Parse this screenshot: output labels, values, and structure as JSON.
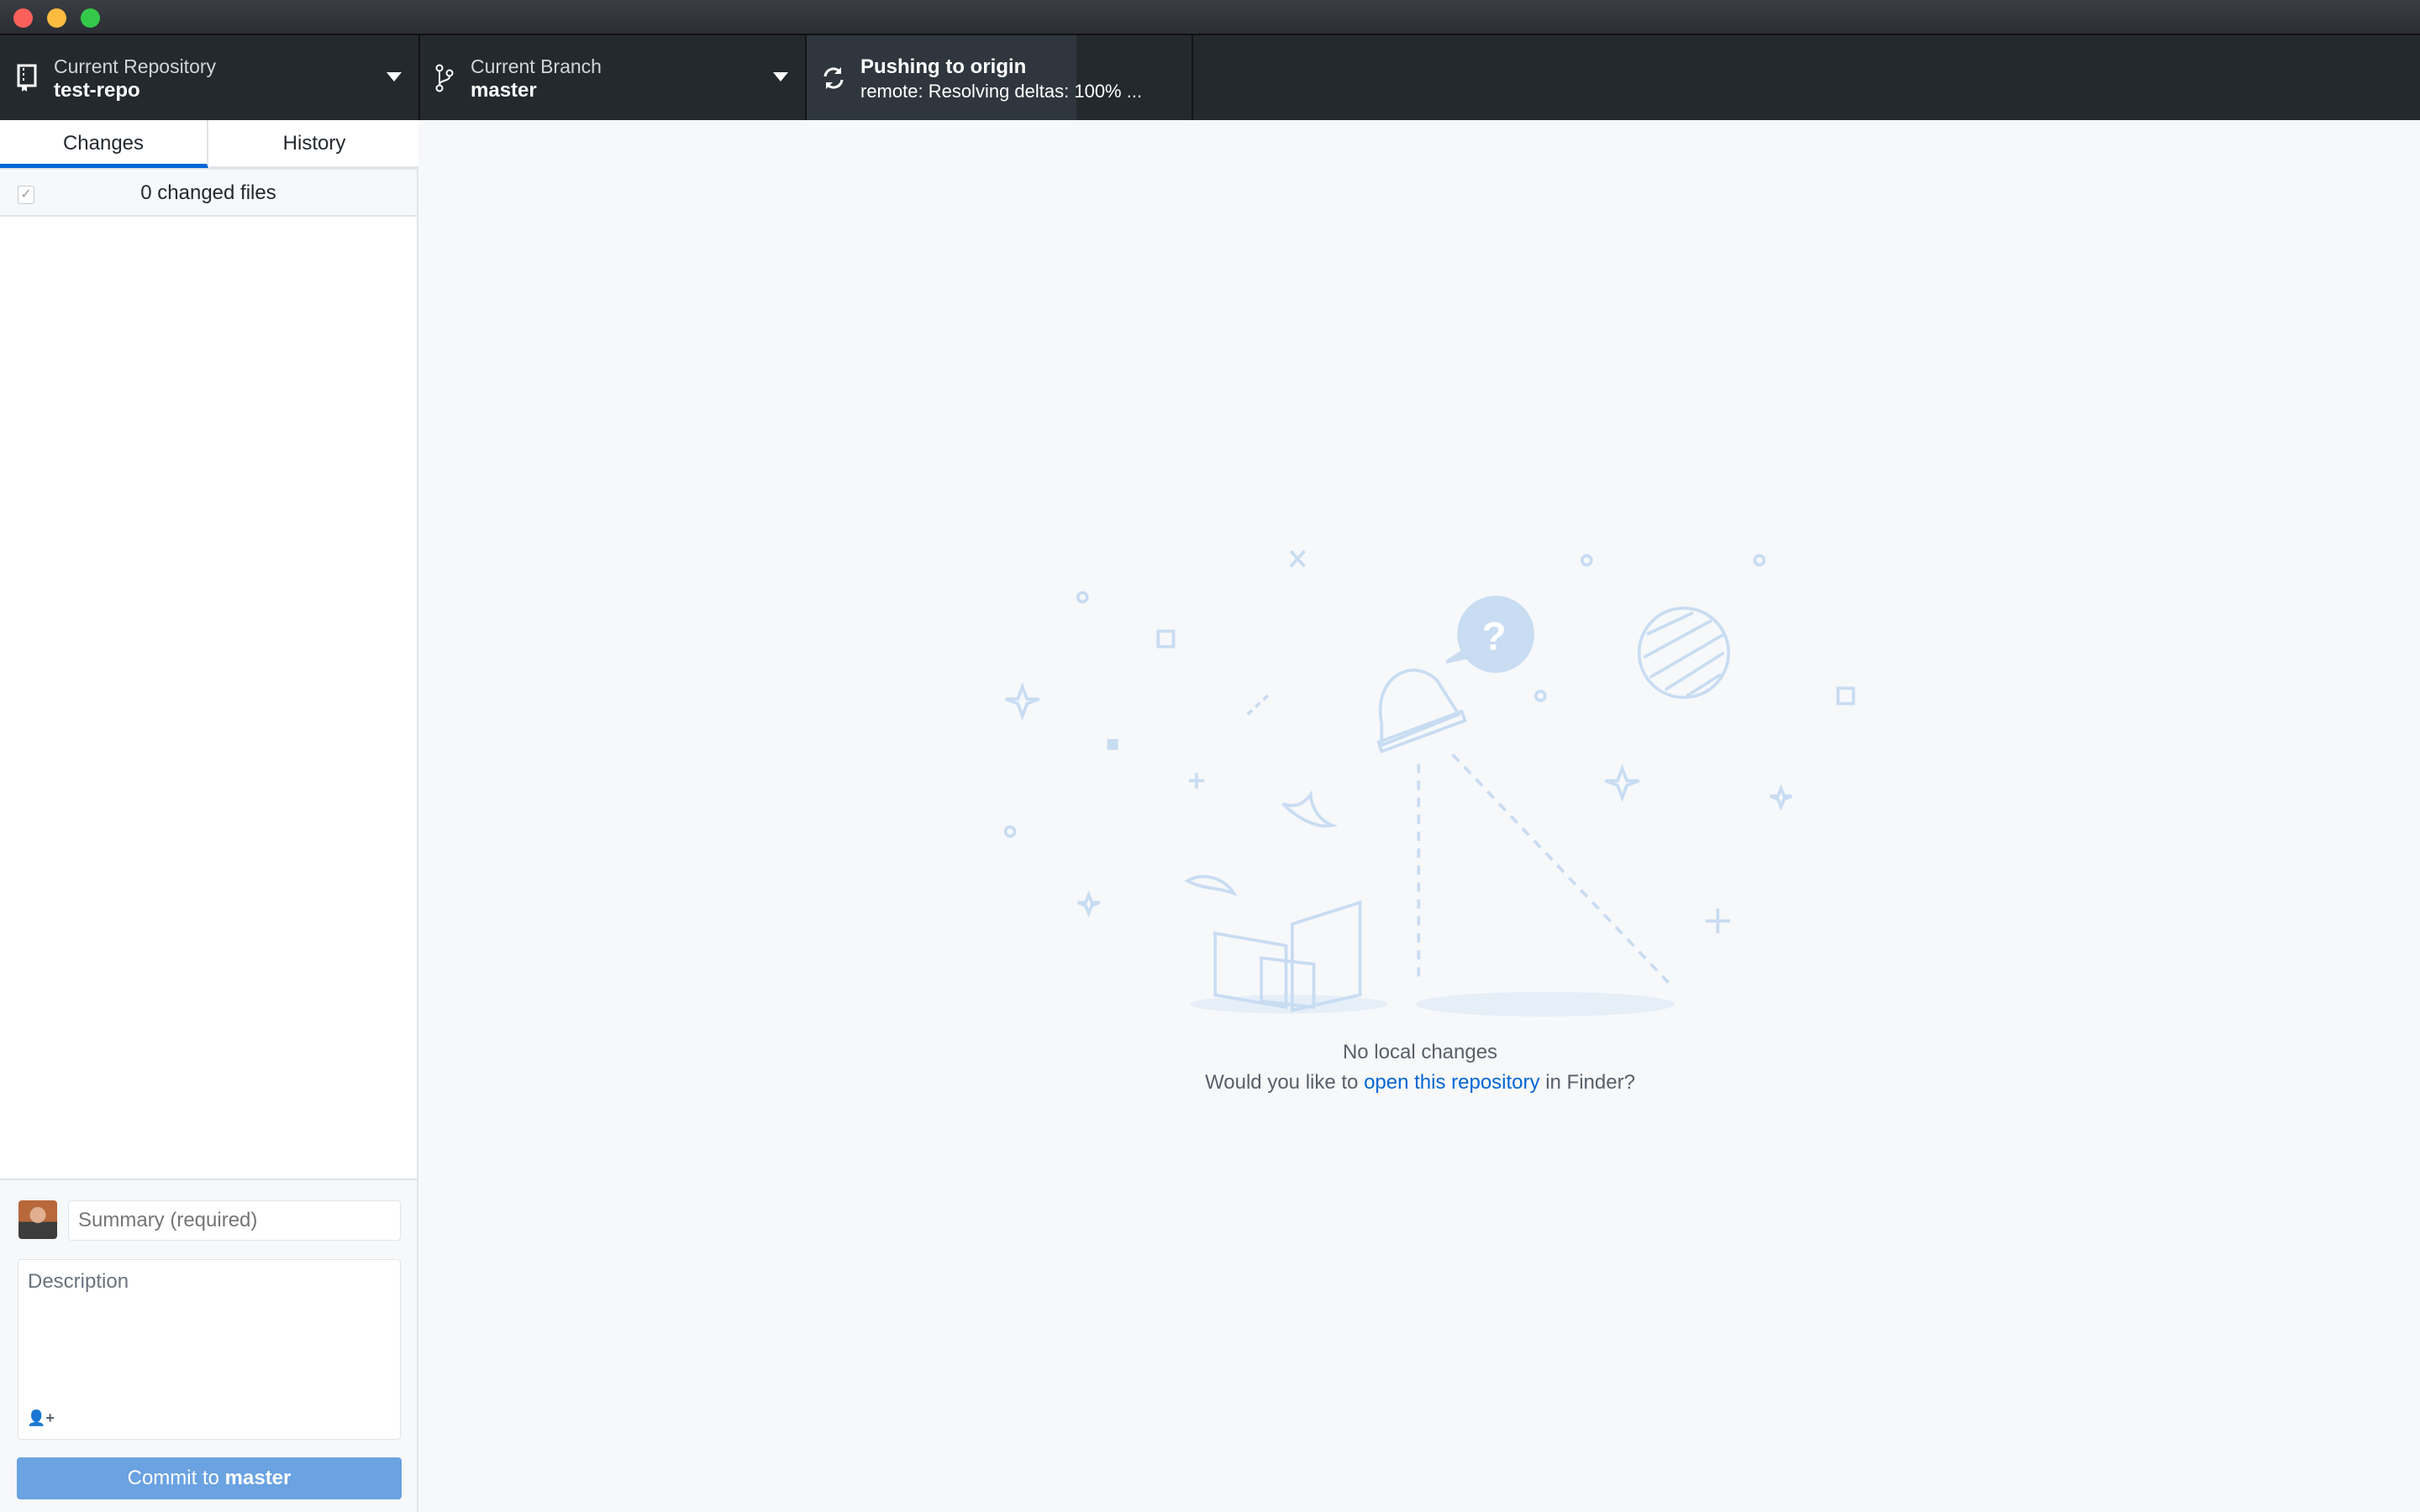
{
  "toolbar": {
    "repository": {
      "label": "Current Repository",
      "value": "test-repo"
    },
    "branch": {
      "label": "Current Branch",
      "value": "master"
    },
    "push": {
      "title": "Pushing to origin",
      "status": "remote: Resolving deltas: 100% ...",
      "progress_percent": 70
    }
  },
  "sidebar": {
    "tabs": [
      {
        "label": "Changes",
        "active": true
      },
      {
        "label": "History",
        "active": false
      }
    ],
    "changed_files": "0 changed files",
    "commit": {
      "summary_placeholder": "Summary (required)",
      "description_placeholder": "Description",
      "button_prefix": "Commit to",
      "button_branch": "master"
    }
  },
  "main": {
    "title": "No local changes",
    "prompt_before": "Would you like to",
    "link": "open this repository",
    "prompt_after": "in Finder?"
  },
  "colors": {
    "accent": "#0366d6",
    "commit_button": "#6aa2e2",
    "toolbar": "#24292e",
    "illustration": "#c8dcf2"
  }
}
